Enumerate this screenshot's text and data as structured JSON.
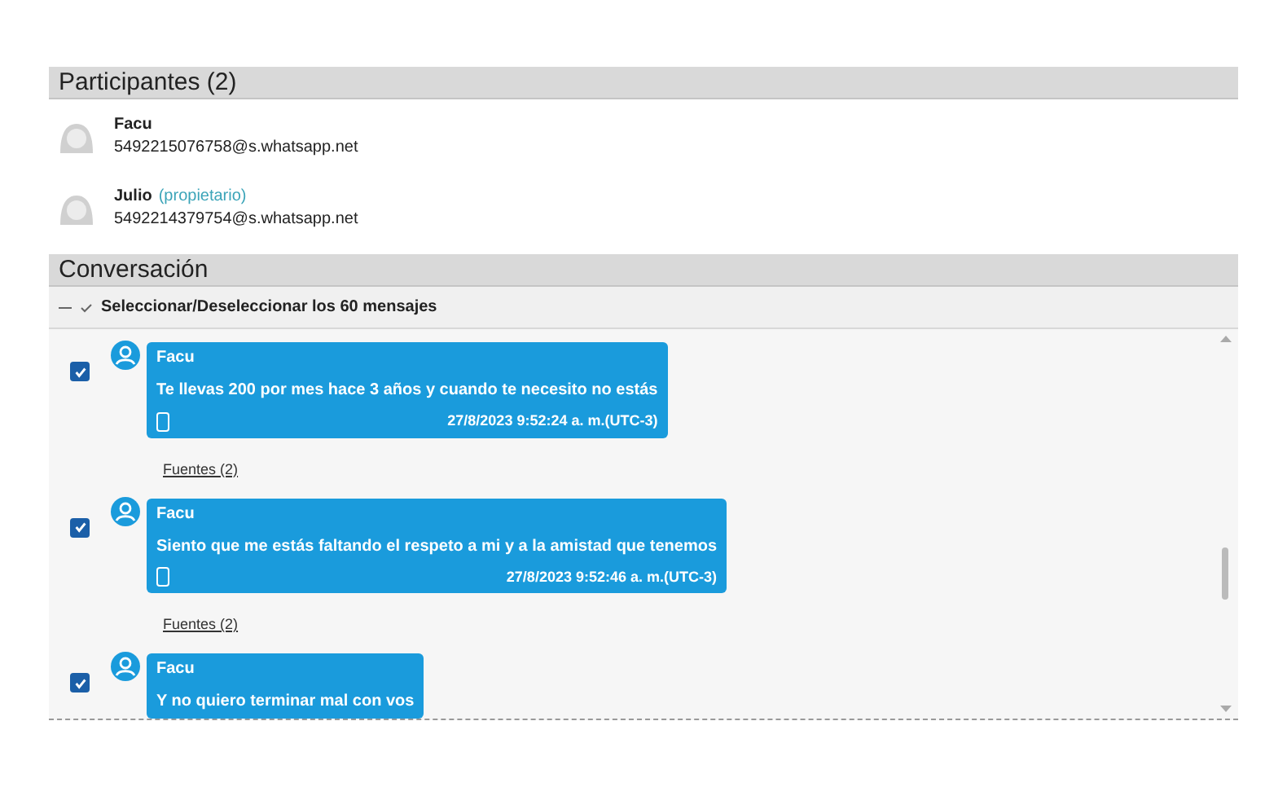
{
  "participants": {
    "title": "Participantes (2)",
    "items": [
      {
        "name": "Facu",
        "id": "5492215076758@s.whatsapp.net"
      },
      {
        "name": "Julio",
        "role": "(propietario)",
        "id": "5492214379754@s.whatsapp.net"
      }
    ]
  },
  "conversation": {
    "title": "Conversación",
    "select_all": {
      "expanded": true,
      "checked": true,
      "label": "Seleccionar/Deseleccionar los 60 mensajes"
    },
    "messages": [
      {
        "checked": true,
        "sender": "Facu",
        "text": "Te llevas 200 por mes hace 3 años y cuando te necesito no estás",
        "timestamp": "27/8/2023 9:52:24 a. m.(UTC-3)",
        "sources": "Fuentes (2)"
      },
      {
        "checked": true,
        "sender": "Facu",
        "text": "Siento que me estás faltando el respeto a mi y a la amistad que tenemos",
        "timestamp": "27/8/2023 9:52:46 a. m.(UTC-3)",
        "sources": "Fuentes (2)"
      },
      {
        "checked": true,
        "sender": "Facu",
        "text": "Y no quiero terminar mal con vos"
      }
    ]
  }
}
